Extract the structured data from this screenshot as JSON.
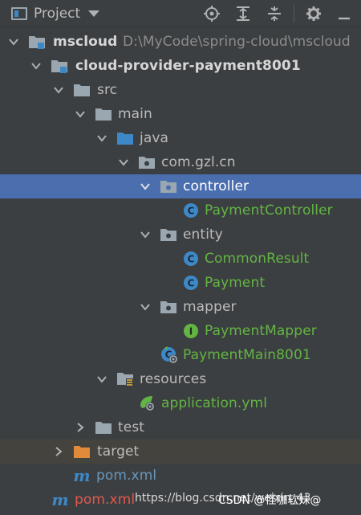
{
  "toolbar": {
    "title": "Project",
    "icons": [
      "locate-icon",
      "expand-all-icon",
      "collapse-all-icon",
      "settings-icon",
      "hide-icon"
    ]
  },
  "tree": {
    "root_name": "mscloud",
    "root_path": "D:\\MyCode\\spring-cloud\\mscloud",
    "module_name": "cloud-provider-payment8001",
    "src": "src",
    "main": "main",
    "java": "java",
    "package": "com.gzl.cn",
    "controller": "controller",
    "payment_controller": "PaymentController",
    "entity": "entity",
    "common_result": "CommonResult",
    "payment": "Payment",
    "mapper": "mapper",
    "payment_mapper": "PaymentMapper",
    "payment_main": "PaymentMain8001",
    "resources": "resources",
    "application_yml": "application.yml",
    "test": "test",
    "target": "target",
    "module_pom": "pom.xml",
    "root_pom": "pom.xml"
  },
  "watermark": {
    "url": "https://blog.csdn.net/weixin_43",
    "author": "CSDN @怪咖软妹@"
  },
  "colors": {
    "background": "#3c3f41",
    "selection": "#4b6eaf",
    "excluded_row": "#45433e",
    "green_text": "#62b543",
    "red_text": "#e0584e",
    "folder_grey": "#9aa7b0",
    "folder_blue": "#3d89c8",
    "folder_orange": "#e08a3c",
    "class_icon": "#3d89c8",
    "interface_icon": "#62b543"
  }
}
